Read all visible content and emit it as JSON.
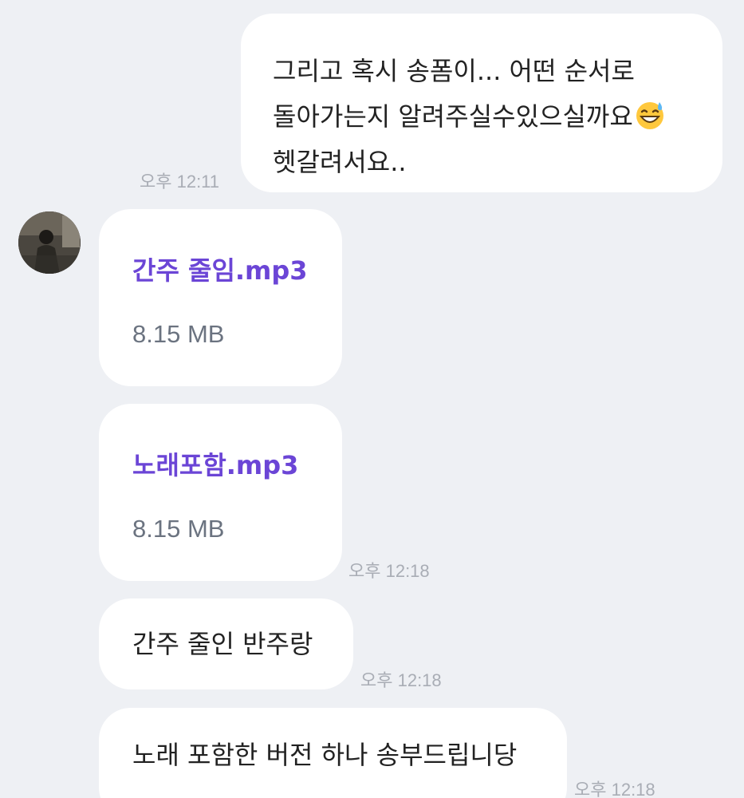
{
  "messages": {
    "m1": {
      "lines": [
        "그리고 혹시 송폼이... 어떤 순서로",
        "돌아가는지 알려주실수있으실까요",
        "헷갈려서요.."
      ],
      "emoji": "grinning-sweat-emoji",
      "time": "오후 12:11"
    },
    "f1": {
      "name": "간주 줄임.mp3",
      "size": "8.15 MB"
    },
    "f2": {
      "name": "노래포함.mp3",
      "size": "8.15 MB",
      "time": "오후 12:18"
    },
    "m2": {
      "text": "간주 줄인 반주랑",
      "time": "오후 12:18"
    },
    "m3": {
      "text": "노래 포함한 버전 하나 송부드립니당",
      "time": "오후 12:18"
    }
  },
  "colors": {
    "background": "#EEF0F4",
    "bubble": "#FFFFFF",
    "file_name": "#6B45D6",
    "file_size": "#6B7380",
    "timestamp": "#A9ADB5"
  }
}
